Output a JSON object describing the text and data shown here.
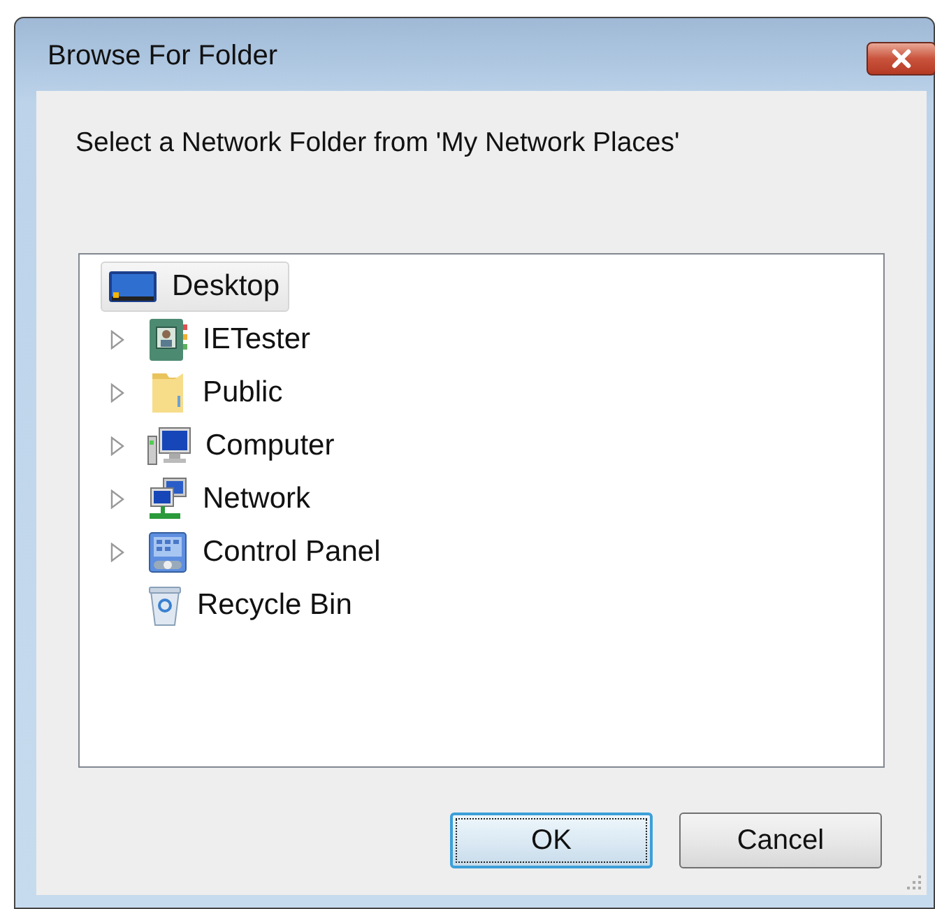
{
  "window": {
    "title": "Browse For Folder"
  },
  "prompt": "Select a Network Folder from 'My Network Places'",
  "tree": [
    {
      "label": "Desktop",
      "kind": "desktop",
      "selected": true,
      "children": [
        {
          "label": "IETester",
          "kind": "contacts",
          "selected": false,
          "expandable": true
        },
        {
          "label": "Public",
          "kind": "folder",
          "selected": false,
          "expandable": true
        },
        {
          "label": "Computer",
          "kind": "computer",
          "selected": false,
          "expandable": true
        },
        {
          "label": "Network",
          "kind": "network",
          "selected": false,
          "expandable": true
        },
        {
          "label": "Control Panel",
          "kind": "control-panel",
          "selected": false,
          "expandable": true
        },
        {
          "label": "Recycle Bin",
          "kind": "recycle-bin",
          "selected": false,
          "expandable": false
        }
      ]
    }
  ],
  "buttons": [
    {
      "label": "OK",
      "default": true
    },
    {
      "label": "Cancel",
      "default": false
    }
  ]
}
